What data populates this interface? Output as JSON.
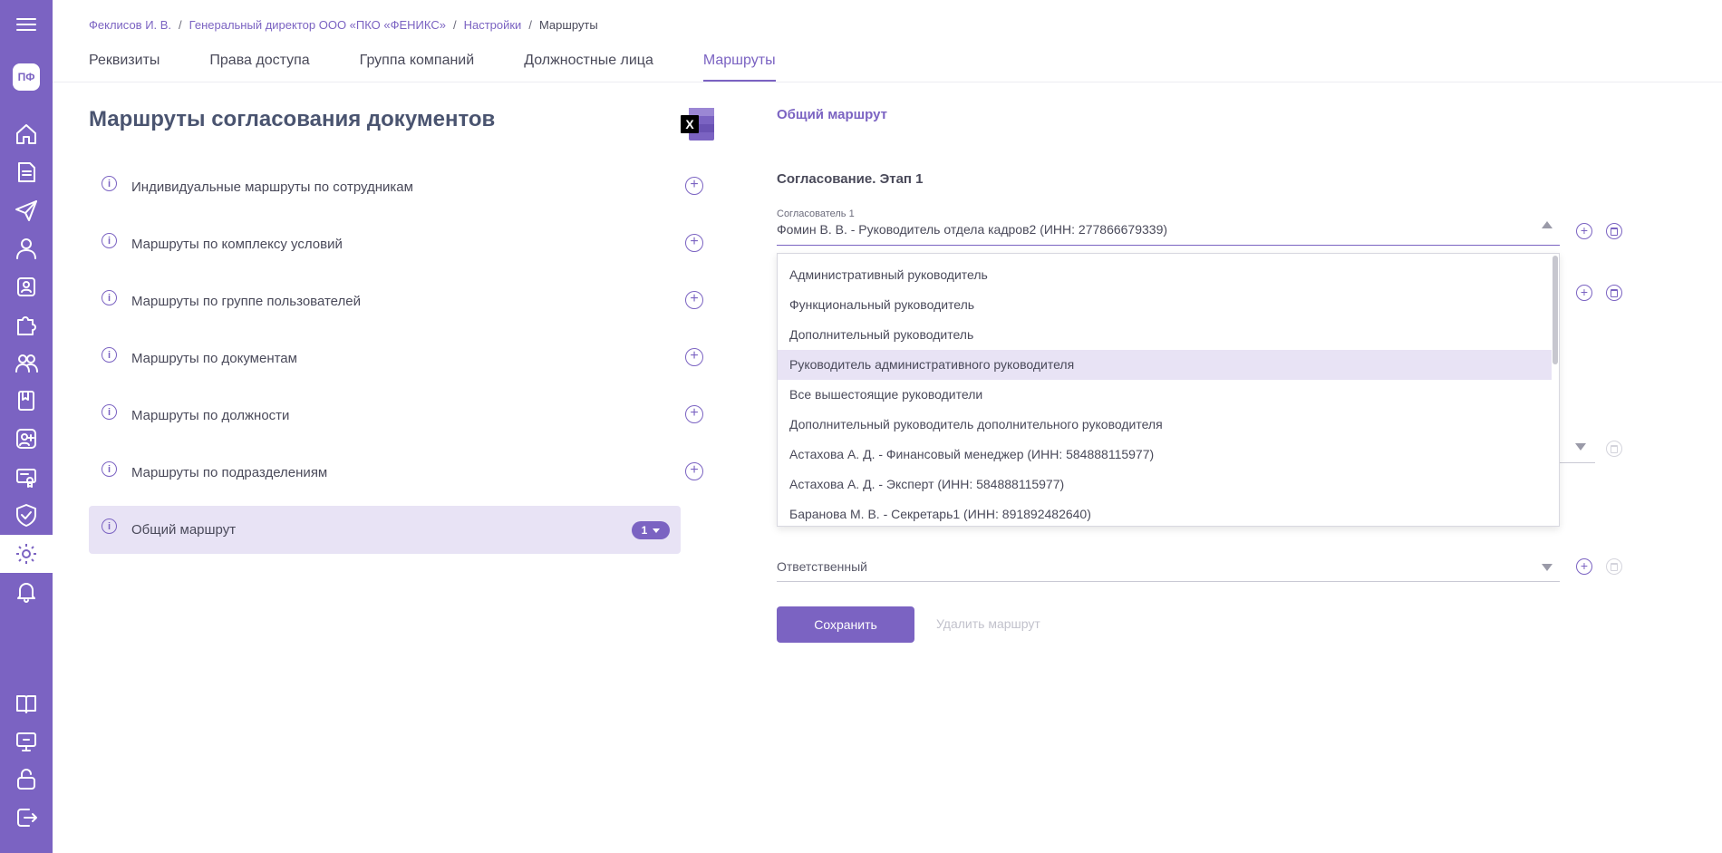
{
  "sidebar": {
    "avatar_initials": "ПФ",
    "icons": [
      "menu-icon",
      "home-icon",
      "documents-icon",
      "send-icon",
      "user-icon",
      "badge-icon",
      "puzzle-icon",
      "users-icon",
      "book-icon",
      "user-plus-icon",
      "certificate-icon",
      "shield-icon",
      "settings-icon",
      "bell-icon",
      "manual-icon",
      "support-icon",
      "lock-icon",
      "logout-icon"
    ],
    "active_icon": "settings-icon",
    "accent_color": "#7b63c2"
  },
  "breadcrumb": {
    "items": [
      "Феклисов И. В.",
      "Генеральный директор ООО «ПКО «ФЕНИКС»",
      "Настройки",
      "Маршруты"
    ],
    "separator": "/"
  },
  "tabs": [
    {
      "label": "Реквизиты",
      "active": false
    },
    {
      "label": "Права доступа",
      "active": false
    },
    {
      "label": "Группа компаний",
      "active": false
    },
    {
      "label": "Должностные лица",
      "active": false
    },
    {
      "label": "Маршруты",
      "active": true
    }
  ],
  "left": {
    "title": "Маршруты согласования документов",
    "excel_label": "X",
    "routes": [
      {
        "label": "Индивидуальные маршруты по сотрудникам",
        "active": false
      },
      {
        "label": "Маршруты по комплексу условий",
        "active": false
      },
      {
        "label": "Маршруты по группе пользователей",
        "active": false
      },
      {
        "label": "Маршруты по документам",
        "active": false
      },
      {
        "label": "Маршруты по должности",
        "active": false
      },
      {
        "label": "Маршруты по подразделениям",
        "active": false
      },
      {
        "label": "Общий маршрут",
        "active": true,
        "badge": "1"
      }
    ],
    "info_glyph": "i",
    "add_glyph": "+"
  },
  "right": {
    "section_title": "Общий маршрут",
    "stage_title": "Согласование. Этап 1",
    "approver": {
      "label": "Согласователь 1",
      "value": "Фомин В. В. - Руководитель отдела кадров2 (ИНН: 277866679339)"
    },
    "dropdown_options": [
      "Административный руководитель",
      "Функциональный руководитель",
      "Дополнительный руководитель",
      "Руководитель административного руководителя",
      "Все вышестоящие руководители",
      "Дополнительный руководитель дополнительного руководителя",
      "Астахова А. Д. - Финансовый менеджер (ИНН: 584888115977)",
      "Астахова А. Д. - Эксперт (ИНН: 584888115977)",
      "Баранова М. В. - Секретарь1 (ИНН: 891892482640)"
    ],
    "highlighted_option_index": 3,
    "responsible": {
      "placeholder": "Ответственный"
    },
    "save_label": "Сохранить",
    "delete_route_label": "Удалить маршрут"
  }
}
